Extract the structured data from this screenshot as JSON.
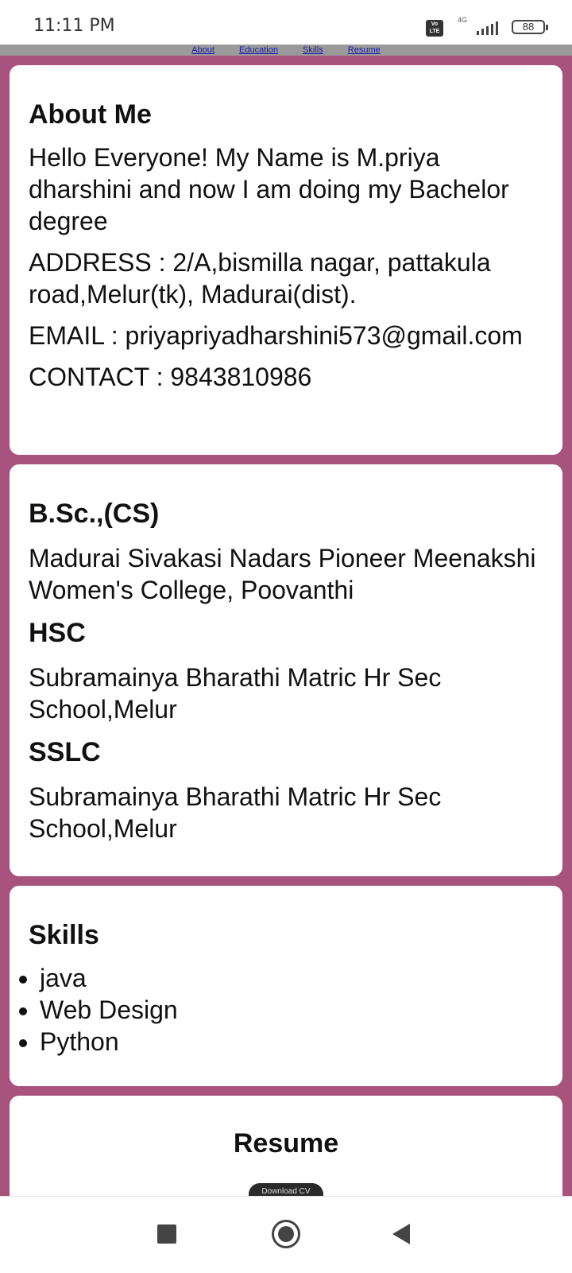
{
  "status_bar": {
    "time": "11:11 PM",
    "volte": "Vo LTE",
    "network": "4G",
    "battery": "88"
  },
  "nav": {
    "links": [
      "About",
      "Education",
      "Skills",
      "Resume"
    ]
  },
  "about": {
    "title": "About Me",
    "intro": "Hello Everyone! My Name is M.priya dharshini and now I am doing my Bachelor degree",
    "address": "ADDRESS : 2/A,bismilla nagar, pattakula road,Melur(tk), Madurai(dist).",
    "email": "EMAIL : priyapriyadharshini573@gmail.com",
    "contact": "CONTACT : 9843810986"
  },
  "education": {
    "degree_title": "B.Sc.,(CS)",
    "degree_school": "Madurai Sivakasi Nadars Pioneer Meenakshi Women's College, Poovanthi",
    "hsc_title": "HSC",
    "hsc_school": "Subramainya Bharathi Matric Hr Sec School,Melur",
    "sslc_title": "SSLC",
    "sslc_school": "Subramainya Bharathi Matric Hr Sec School,Melur"
  },
  "skills": {
    "title": "Skills",
    "items": [
      "java",
      "Web Design",
      "Python"
    ]
  },
  "resume": {
    "title": "Resume",
    "button_label": "Download CV"
  },
  "colors": {
    "page_background": "#a8527e",
    "navbar_background": "#9a9a9a",
    "link_color": "#1a1aa6"
  }
}
